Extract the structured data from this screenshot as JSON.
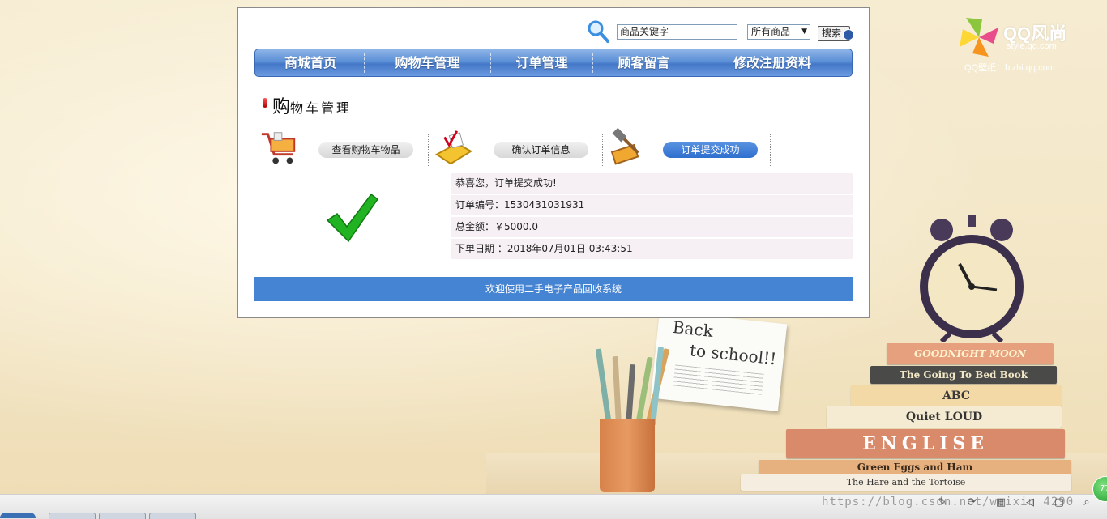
{
  "search": {
    "value": "商品关键字",
    "category": "所有商品",
    "button": "搜索"
  },
  "nav": {
    "items": [
      "商城首页",
      "购物车管理",
      "订单管理",
      "顾客留言",
      "修改注册资料"
    ]
  },
  "page_title": {
    "first_char": "购",
    "rest": "物车管理"
  },
  "steps": [
    {
      "label": "查看购物车物品",
      "icon": "shopping-cart-icon",
      "active": false
    },
    {
      "label": "确认订单信息",
      "icon": "calculator-icon",
      "active": false
    },
    {
      "label": "订单提交成功",
      "icon": "hammer-icon",
      "active": true
    }
  ],
  "order": {
    "success": "恭喜您，订单提交成功!",
    "number": "订单编号：1530431031931",
    "total": "总金额：￥5000.0",
    "date": "下单日期 ：2018年07月01日 03:43:51"
  },
  "footer": "欢迎使用二手电子产品回收系统",
  "wallpaper": {
    "logo_title": "QQ风尚",
    "logo_sub": "style.qq.com",
    "logo_wp": "QQ壁纸：bizhi.qq.com",
    "note_line1": "Back",
    "note_line2": "to school!!",
    "books": [
      "GOODNIGHT MOON",
      "The Going To Bed Book",
      "ABC",
      "Quiet LOUD",
      "ENGLISE",
      "Green Eggs and Ham",
      "The Hare and the Tortoise"
    ]
  },
  "taskbar": {
    "watermark": "https://blog.csdn.net/weixin_4290",
    "badge": "77"
  },
  "colors": {
    "nav_blue": "#4a7fcf",
    "footer_blue": "#4583d3",
    "active_step": "#2f6fcf",
    "info_row": "#f6f0f4"
  }
}
